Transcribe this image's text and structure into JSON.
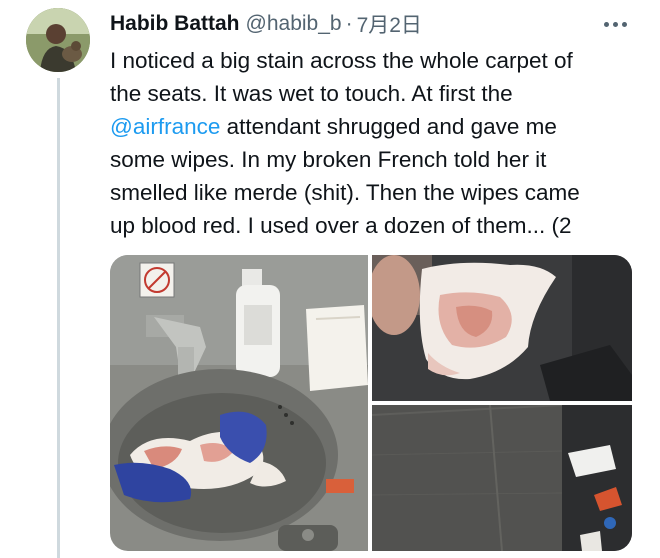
{
  "tweet": {
    "display_name": "Habib Battah",
    "handle": "@habib_b",
    "separator": "·",
    "date": "7月2日",
    "lines": [
      {
        "text": "I noticed a big stain across the whole carpet of"
      },
      {
        "text": "the seats. It was wet to touch. At first the"
      },
      {
        "mention": "@airfrance",
        "text": " attendant shrugged and gave me"
      },
      {
        "text": "some wipes. In my broken French told her it"
      },
      {
        "text": "smelled like merde (shit).  Then the wipes came"
      },
      {
        "text": "up blood red. I used over a dozen of them... (2"
      }
    ]
  },
  "media": {
    "photos": [
      {
        "icon": "sink-photo"
      },
      {
        "icon": "wipes-photo"
      },
      {
        "icon": "carpet-stain-photo"
      }
    ],
    "colors": {
      "sink_basin": "#6e6f6b",
      "counter": "#8c8d88",
      "wipe_red": "#c96a5a",
      "glove_blue": "#3a4fae",
      "carpet": "#4a4a48"
    }
  },
  "colors": {
    "link": "#1d9bf0",
    "secondary_text": "#536471",
    "thread_line": "#cfd9de"
  }
}
